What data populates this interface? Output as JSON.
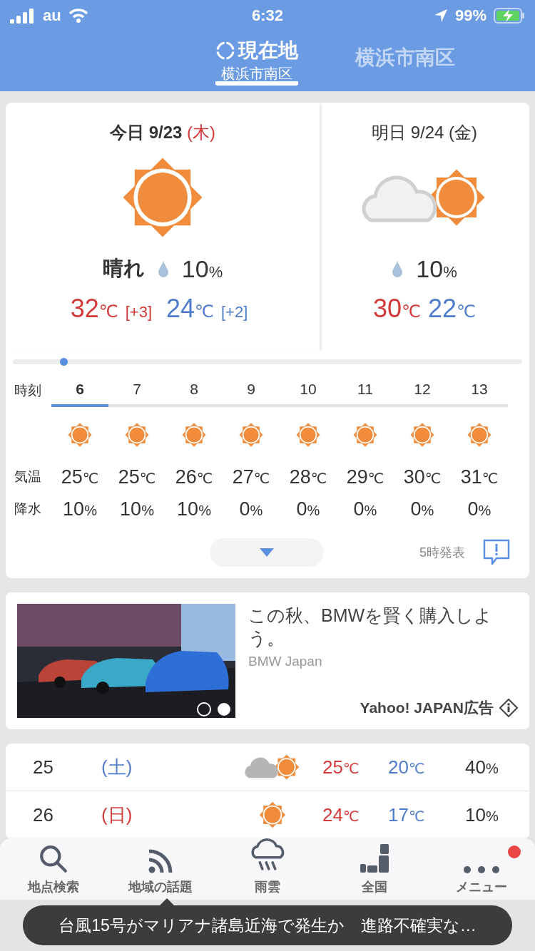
{
  "status_bar": {
    "carrier": "au",
    "time": "6:32",
    "battery": "99%"
  },
  "header": {
    "tabs": [
      {
        "title": "現在地",
        "subtitle": "横浜市南区",
        "kind": "location",
        "selected": true
      },
      {
        "title": "横浜市南区",
        "kind": "plain",
        "selected": false
      }
    ]
  },
  "forecast": [
    {
      "label": "今日",
      "date": "9/23",
      "weekday": "(木)",
      "holiday": true,
      "kind": "sunny",
      "weather": "晴れ",
      "rain": [
        "10",
        "%"
      ],
      "high": [
        "32",
        "℃"
      ],
      "high_diff": "[+3]",
      "low": [
        "24",
        "℃"
      ],
      "low_diff": "[+2]"
    },
    {
      "label": "明日",
      "date": "9/24",
      "weekday": "(金)",
      "holiday": false,
      "kind": "cloudy_sunny",
      "rain": [
        "10",
        "%"
      ],
      "high": [
        "30",
        "℃"
      ],
      "low": [
        "22",
        "℃"
      ]
    }
  ],
  "timeline": {
    "level": 0.1
  },
  "hourly": {
    "row_labels": [
      "時刻",
      "気温",
      "降水"
    ],
    "hours": [
      {
        "hour": "6",
        "kind": "sunny",
        "temp": [
          "25",
          "℃"
        ],
        "rain": [
          "10",
          "%"
        ],
        "selected": true
      },
      {
        "hour": "7",
        "kind": "sunny",
        "temp": [
          "25",
          "℃"
        ],
        "rain": [
          "10",
          "%"
        ],
        "selected": false
      },
      {
        "hour": "8",
        "kind": "sunny",
        "temp": [
          "26",
          "℃"
        ],
        "rain": [
          "10",
          "%"
        ],
        "selected": false
      },
      {
        "hour": "9",
        "kind": "sunny",
        "temp": [
          "27",
          "℃"
        ],
        "rain": [
          "0",
          "%"
        ],
        "selected": false
      },
      {
        "hour": "10",
        "kind": "sunny",
        "temp": [
          "28",
          "℃"
        ],
        "rain": [
          "0",
          "%"
        ],
        "selected": false
      },
      {
        "hour": "11",
        "kind": "sunny",
        "temp": [
          "29",
          "℃"
        ],
        "rain": [
          "0",
          "%"
        ],
        "selected": false
      },
      {
        "hour": "12",
        "kind": "sunny",
        "temp": [
          "30",
          "℃"
        ],
        "rain": [
          "0",
          "%"
        ],
        "selected": false
      },
      {
        "hour": "13",
        "kind": "sunny",
        "temp": [
          "31",
          "℃"
        ],
        "rain": [
          "0",
          "%"
        ],
        "selected": false
      }
    ],
    "issued": "5時発表"
  },
  "ad": {
    "kind": "picture",
    "headline": "この秋、BMWを賢く購入しよう。",
    "advertiser": "BMW Japan",
    "label": "Yahoo! JAPAN広告"
  },
  "daily": [
    {
      "day": "25",
      "weekday": "(土)",
      "color": "#4f7ccb",
      "kind": "cloudy_sunny",
      "high": [
        "25",
        "℃"
      ],
      "low": [
        "20",
        "℃"
      ],
      "rain": [
        "40",
        "%"
      ]
    },
    {
      "day": "26",
      "weekday": "(日)",
      "color": "#d33a3a",
      "kind": "sunny",
      "high": [
        "24",
        "℃"
      ],
      "low": [
        "17",
        "℃"
      ],
      "rain": [
        "10",
        "%"
      ]
    }
  ],
  "tab_bar": [
    {
      "label": "地点検索",
      "kind": "search",
      "badge": false
    },
    {
      "label": "地域の話題",
      "kind": "feed",
      "badge": false
    },
    {
      "label": "雨雲",
      "kind": "rain",
      "badge": false
    },
    {
      "label": "全国",
      "kind": "nation",
      "badge": false
    },
    {
      "label": "メニュー",
      "kind": "menu",
      "badge": true
    }
  ],
  "toast": "台風15号がマリアナ諸島近海で発生か　進路不確実な…"
}
